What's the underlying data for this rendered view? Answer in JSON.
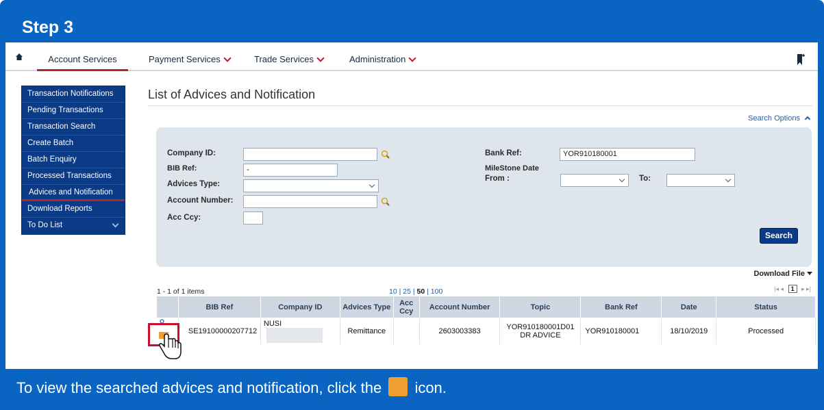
{
  "step": {
    "title": "Step 3"
  },
  "nav": {
    "items": [
      {
        "label": "Account Services"
      },
      {
        "label": "Payment Services"
      },
      {
        "label": "Trade Services"
      },
      {
        "label": "Administration"
      }
    ]
  },
  "sidebar": {
    "items": [
      {
        "label": "Transaction Notifications"
      },
      {
        "label": "Pending Transactions"
      },
      {
        "label": "Transaction Search"
      },
      {
        "label": "Create Batch"
      },
      {
        "label": "Batch Enquiry"
      },
      {
        "label": "Processed Transactions"
      },
      {
        "label": "Advices and Notification"
      },
      {
        "label": "Download Reports"
      },
      {
        "label": "To Do List"
      }
    ]
  },
  "main": {
    "title": "List of Advices and Notification",
    "search_options_label": "Search Options"
  },
  "form": {
    "company_id_label": "Company ID:",
    "company_id_value": "",
    "bib_ref_label": "BIB Ref:",
    "bib_ref_value": "-",
    "advices_type_label": "Advices Type:",
    "account_number_label": "Account Number:",
    "acc_ccy_label": "Acc Ccy:",
    "bank_ref_label": "Bank Ref:",
    "bank_ref_value": "YOR910180001",
    "milestone_label": "MileStone Date",
    "from_label": "From :",
    "to_label": "To:",
    "search_button": "Search"
  },
  "results": {
    "download_label": "Download File",
    "items_count": "1 - 1 of 1 items",
    "page_size_10": "10",
    "page_size_25": "25",
    "page_size_50": "50",
    "page_size_100": "100",
    "sep": "|",
    "current_page": "1",
    "columns": [
      "BIB Ref",
      "Company ID",
      "Advices Type",
      "Acc Ccy",
      "Account Number",
      "Topic",
      "Bank Ref",
      "Date",
      "Status"
    ],
    "row": {
      "bib_ref": "SE19100000207712",
      "company_id": "NUSI",
      "advices_type": "Remittance",
      "acc_ccy": "",
      "account_number": "2603003383",
      "topic": "YOR910180001D01 DR ADVICE",
      "bank_ref": "YOR910180001",
      "date": "18/10/2019",
      "status": "Processed"
    }
  },
  "caption": {
    "before": "To view the searched advices and notification, click the",
    "after": "icon."
  },
  "colors": {
    "brand_blue": "#0a64c2",
    "sidebar_navy": "#0b3a86",
    "highlight_red": "#c8102e"
  }
}
